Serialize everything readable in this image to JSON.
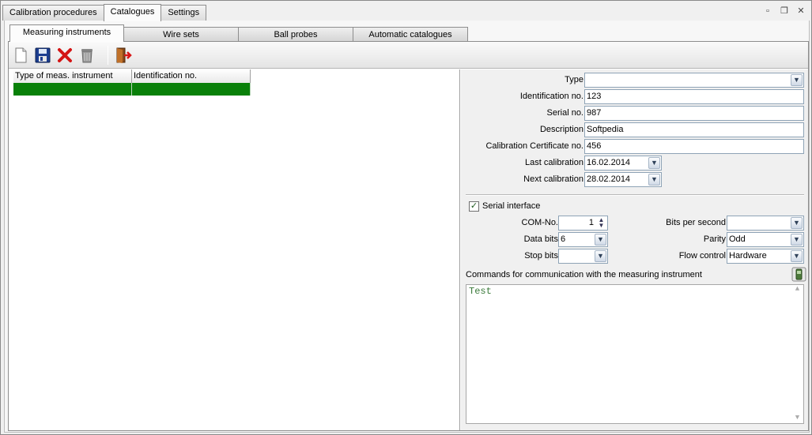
{
  "top_tabs": [
    "Calibration procedures",
    "Catalogues",
    "Settings"
  ],
  "top_tab_active": 1,
  "window_controls": {
    "minimize_icon": "minimize-icon",
    "restore_icon": "restore-icon",
    "close_icon": "close-icon"
  },
  "sub_tabs": [
    "Measuring instruments",
    "Wire sets",
    "Ball probes",
    "Automatic catalogues"
  ],
  "sub_tab_active": 0,
  "toolbar": {
    "buttons": [
      "new-document-icon",
      "save-icon",
      "delete-icon",
      "trash-icon",
      "exit-door-icon"
    ]
  },
  "list": {
    "columns": [
      "Type of meas. instrument",
      "Identification no."
    ],
    "rows": [
      [
        "",
        ""
      ]
    ],
    "selected_row": 0
  },
  "form": {
    "type_label": "Type",
    "type_value": "",
    "identification_label": "Identification no.",
    "identification_value": "123",
    "serial_label": "Serial no.",
    "serial_value": "987",
    "description_label": "Description",
    "description_value": "Softpedia",
    "cert_label": "Calibration Certificate no.",
    "cert_value": "456",
    "last_cal_label": "Last calibration",
    "last_cal_value": "16.02.2014",
    "next_cal_label": "Next calibration",
    "next_cal_value": "28.02.2014"
  },
  "serial": {
    "checkbox_label": "Serial interface",
    "checked": true,
    "com_label": "COM-No.",
    "com_value": "1",
    "databits_label": "Data bits",
    "databits_value": "6",
    "stopbits_label": "Stop bits",
    "stopbits_value": "",
    "bps_label": "Bits per second",
    "bps_value": "",
    "parity_label": "Parity",
    "parity_value": "Odd",
    "flow_label": "Flow control",
    "flow_value": "Hardware"
  },
  "commands": {
    "label": "Commands for communication with the measuring instrument",
    "text": "Test"
  },
  "colors": {
    "selection": "#098009",
    "memo_text": "#3a7a3a"
  }
}
